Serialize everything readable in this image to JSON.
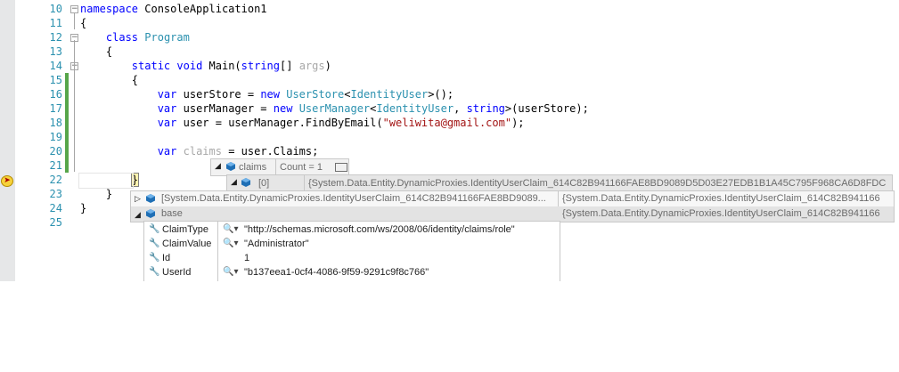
{
  "editor": {
    "lines": [
      {
        "num": "10",
        "parts": [
          {
            "t": "namespace",
            "c": "kw"
          },
          {
            "t": " ConsoleApplication1",
            "c": ""
          }
        ]
      },
      {
        "num": "11",
        "parts": [
          {
            "t": "{",
            "c": ""
          }
        ]
      },
      {
        "num": "12",
        "parts": [
          {
            "t": "    ",
            "c": ""
          },
          {
            "t": "class",
            "c": "kw"
          },
          {
            "t": " ",
            "c": ""
          },
          {
            "t": "Program",
            "c": "ty"
          }
        ]
      },
      {
        "num": "13",
        "parts": [
          {
            "t": "    {",
            "c": ""
          }
        ]
      },
      {
        "num": "14",
        "parts": [
          {
            "t": "        ",
            "c": ""
          },
          {
            "t": "static",
            "c": "kw"
          },
          {
            "t": " ",
            "c": ""
          },
          {
            "t": "void",
            "c": "kw"
          },
          {
            "t": " Main(",
            "c": ""
          },
          {
            "t": "string",
            "c": "kw"
          },
          {
            "t": "[] ",
            "c": ""
          },
          {
            "t": "args",
            "c": "gray"
          },
          {
            "t": ")",
            "c": ""
          }
        ]
      },
      {
        "num": "15",
        "parts": [
          {
            "t": "        {",
            "c": ""
          }
        ]
      },
      {
        "num": "16",
        "parts": [
          {
            "t": "            ",
            "c": ""
          },
          {
            "t": "var",
            "c": "kw"
          },
          {
            "t": " userStore = ",
            "c": ""
          },
          {
            "t": "new",
            "c": "kw"
          },
          {
            "t": " ",
            "c": ""
          },
          {
            "t": "UserStore",
            "c": "ty"
          },
          {
            "t": "<",
            "c": ""
          },
          {
            "t": "IdentityUser",
            "c": "ty"
          },
          {
            "t": ">();",
            "c": ""
          }
        ]
      },
      {
        "num": "17",
        "parts": [
          {
            "t": "            ",
            "c": ""
          },
          {
            "t": "var",
            "c": "kw"
          },
          {
            "t": " userManager = ",
            "c": ""
          },
          {
            "t": "new",
            "c": "kw"
          },
          {
            "t": " ",
            "c": ""
          },
          {
            "t": "UserManager",
            "c": "ty"
          },
          {
            "t": "<",
            "c": ""
          },
          {
            "t": "IdentityUser",
            "c": "ty"
          },
          {
            "t": ", ",
            "c": ""
          },
          {
            "t": "string",
            "c": "kw"
          },
          {
            "t": ">(userStore);",
            "c": ""
          }
        ]
      },
      {
        "num": "18",
        "parts": [
          {
            "t": "            ",
            "c": ""
          },
          {
            "t": "var",
            "c": "kw"
          },
          {
            "t": " user = userManager.FindByEmail(",
            "c": ""
          },
          {
            "t": "\"weliwita@gmail.com\"",
            "c": "str"
          },
          {
            "t": ");",
            "c": ""
          }
        ]
      },
      {
        "num": "19",
        "parts": []
      },
      {
        "num": "20",
        "parts": [
          {
            "t": "            ",
            "c": ""
          },
          {
            "t": "var",
            "c": "kw"
          },
          {
            "t": " ",
            "c": ""
          },
          {
            "t": "claims",
            "c": "gray"
          },
          {
            "t": " = user.Claims;",
            "c": ""
          }
        ]
      },
      {
        "num": "21",
        "parts": []
      },
      {
        "num": "22",
        "parts": [
          {
            "t": "        ",
            "c": ""
          },
          {
            "t": "}",
            "c": "curly"
          }
        ]
      },
      {
        "num": "23",
        "parts": [
          {
            "t": "    }",
            "c": ""
          }
        ]
      },
      {
        "num": "24",
        "parts": [
          {
            "t": "}",
            "c": ""
          }
        ]
      },
      {
        "num": "25",
        "parts": []
      }
    ],
    "changed_lines": [
      "15",
      "16",
      "17",
      "18",
      "19",
      "20",
      "21"
    ],
    "fold_lines": [
      "10",
      "12",
      "14"
    ],
    "current_line": "22"
  },
  "datatip": {
    "claims": {
      "name": "claims",
      "value": "Count = 1"
    },
    "item0": {
      "name": "[0]",
      "value": "{System.Data.Entity.DynamicProxies.IdentityUserClaim_614C82B941166FAE8BD9089D5D03E27EDB1B1A45C795F968CA6D8FDC"
    },
    "rows": [
      {
        "name": "[System.Data.Entity.DynamicProxies.IdentityUserClaim_614C82B941166FAE8BD9089...",
        "value": "{System.Data.Entity.DynamicProxies.IdentityUserClaim_614C82B941166"
      },
      {
        "name": "base",
        "value": "{System.Data.Entity.DynamicProxies.IdentityUserClaim_614C82B941166"
      }
    ],
    "props": [
      {
        "name": "ClaimType",
        "value": "\"http://schemas.microsoft.com/ws/2008/06/identity/claims/role\"",
        "viz": true
      },
      {
        "name": "ClaimValue",
        "value": "\"Administrator\"",
        "viz": true
      },
      {
        "name": "Id",
        "value": "1",
        "viz": false
      },
      {
        "name": "UserId",
        "value": "\"b137eea1-0cf4-4086-9f59-9291c9f8c766\"",
        "viz": true
      }
    ]
  },
  "icons": {
    "breakpoint": "current-statement-arrow-icon",
    "field": "field-cube-icon",
    "property": "property-wrench-icon",
    "visualizer": "magnifier-icon"
  },
  "colors": {
    "keyword": "#0000ff",
    "type": "#2b91af",
    "string": "#a31515",
    "change_bar": "#57a64a",
    "field_icon": "#1f6fb5"
  }
}
